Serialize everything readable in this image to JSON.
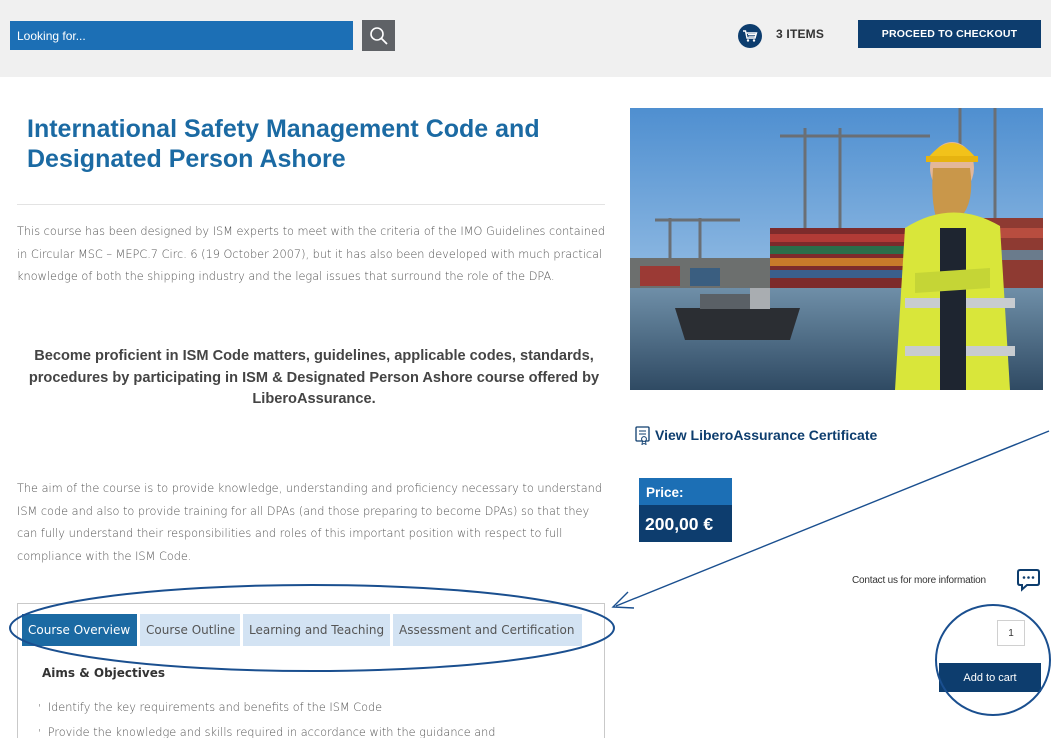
{
  "header": {
    "search_placeholder": "Looking for...",
    "cart_count": "3 ITEMS",
    "checkout_label": "PROCEED TO CHECKOUT"
  },
  "course": {
    "title": "International Safety Management Code and Designated Person Ashore",
    "intro": "This course has been designed by ISM experts to meet with the criteria of the IMO Guidelines contained in Circular MSC – MEPC.7 Circ. 6 (19 October 2007), but it has also been developed with much practical knowledge of both the shipping industry and the legal issues that surround the role of the DPA.",
    "highlight": "Become proficient in ISM Code matters, guidelines, applicable codes, standards, procedures by participating in ISM & Designated Person Ashore course offered by LiberoAssurance.",
    "aim": "The aim of the course is to provide knowledge, understanding and proficiency necessary to understand ISM code and also to provide training for all DPAs (and those preparing to become DPAs) so that they can fully understand their responsibilities and roles of this important position with respect to full compliance with the ISM Code."
  },
  "tabs": [
    {
      "label": "Course Overview",
      "active": true
    },
    {
      "label": "Course Outline",
      "active": false
    },
    {
      "label": "Learning and Teaching",
      "active": false
    },
    {
      "label": "Assessment and Certification",
      "active": false
    }
  ],
  "overview": {
    "heading": "Aims & Objectives",
    "bullet_glyph": "'",
    "items": [
      "Identify the key requirements and benefits of the ISM Code",
      "Provide the knowledge and skills required in accordance with the guidance and"
    ]
  },
  "product": {
    "certificate_link": "View LiberoAssurance Certificate",
    "price_label": "Price:",
    "price_value": "200,00 €",
    "contact_text": "Contact us for more information",
    "quantity": "1",
    "add_to_cart_label": "Add to cart"
  },
  "colors": {
    "brand_blue": "#1b6aa3",
    "search_blue": "#1c6fb5",
    "navy": "#0d3d6e",
    "tab_inactive": "#d3e3f3",
    "annotation": "#1a4f8f"
  }
}
